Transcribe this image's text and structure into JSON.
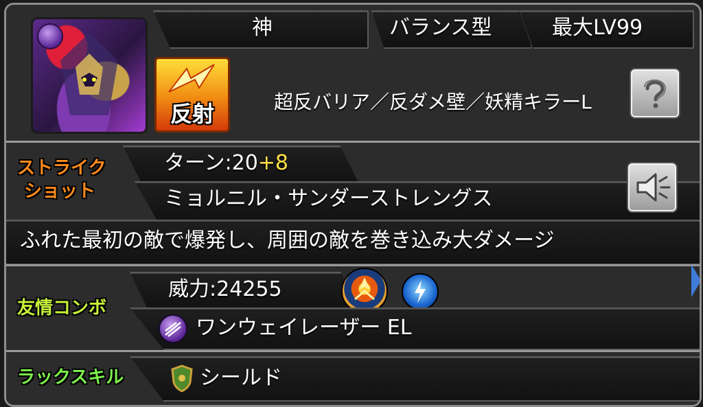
{
  "header": {
    "tribe": "神",
    "type": "バランス型",
    "max_level": "最大LV99",
    "rebound_badge_label": "反射",
    "abilities": "超反バリア／反ダメ壁／妖精キラーL"
  },
  "strike_shot": {
    "section_label_line1": "ストライク",
    "section_label_line2": "ショット",
    "turns_label": "ターン:20",
    "turns_bonus": "+8",
    "name": "ミョルニル・サンダーストレングス",
    "description": "ふれた最初の敵で爆発し、周囲の敵を巻き込み大ダメージ"
  },
  "friendship_combo": {
    "section_label": "友情コンボ",
    "power": "威力:24255",
    "name": "ワンウェイレーザー EL"
  },
  "luck_skill": {
    "section_label": "ラックスキル",
    "name": "シールド"
  },
  "colors": {
    "strike_label": "#ff8a1c",
    "friend_label": "#c7f23a",
    "luck_label": "#7df04b",
    "bonus": "#ffe24a",
    "side_arrow": "#3f7bd8"
  },
  "icons": {
    "character_portrait": "character-portrait",
    "element": "dark-element-icon",
    "rebound": "rebound-badge",
    "gimmick_help": "question-icon",
    "voice": "speaker-icon",
    "friend_badge_1": "friend-combo-badge-icon",
    "friend_badge_2": "lightning-badge-icon",
    "laser": "laser-icon",
    "shield": "shield-icon"
  }
}
